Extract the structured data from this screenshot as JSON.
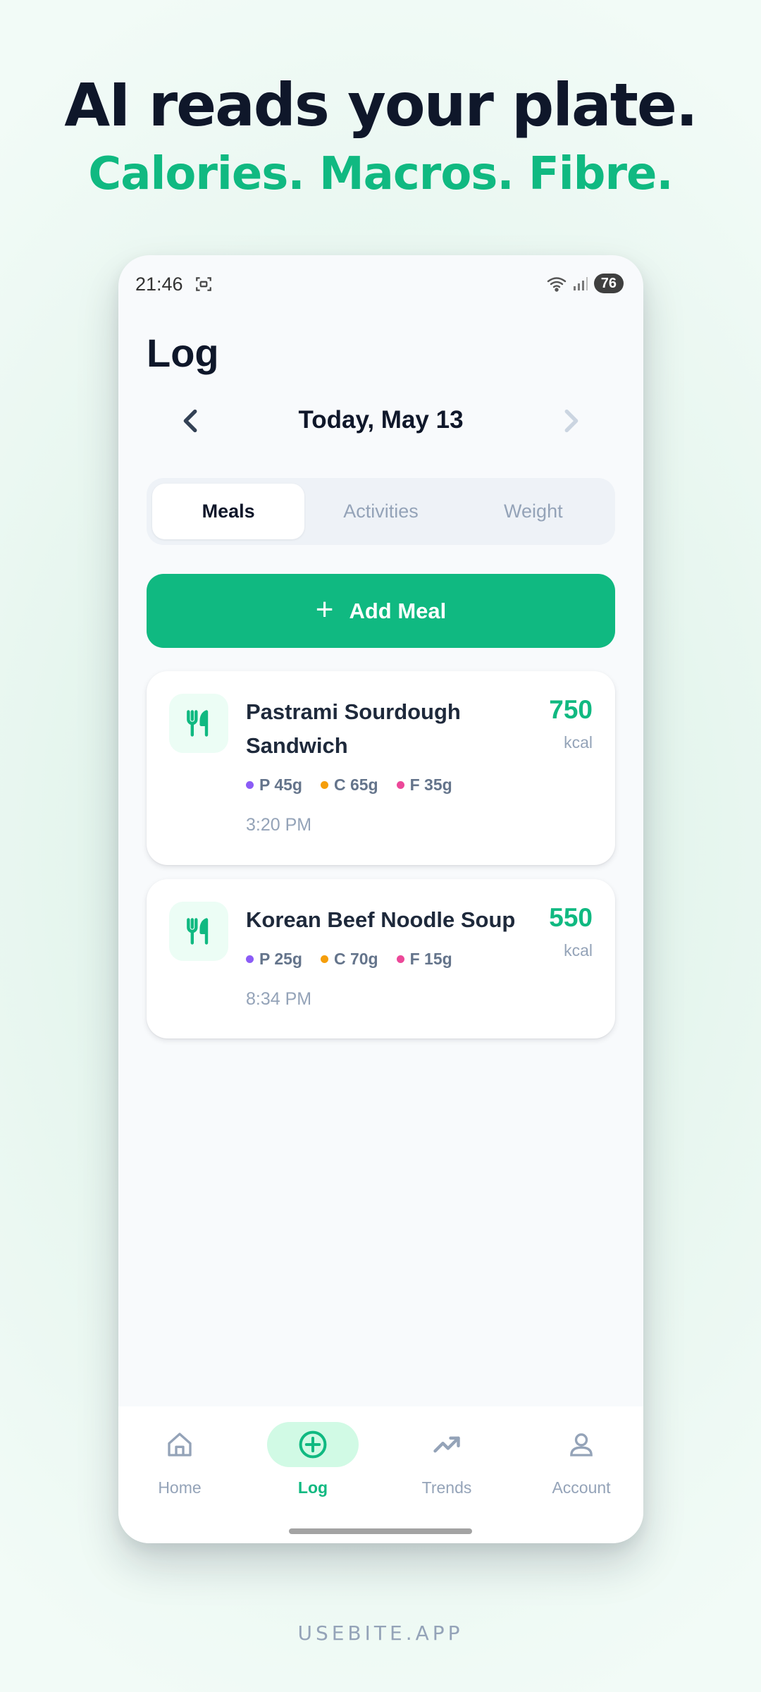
{
  "promo": {
    "headline": "AI reads your plate.",
    "subline": "Calories. Macros. Fibre.",
    "brand": "USEBITE.APP"
  },
  "status_bar": {
    "time": "21:46",
    "battery": "76"
  },
  "page": {
    "title": "Log",
    "date": "Today, May 13"
  },
  "tabs": [
    {
      "label": "Meals",
      "active": true
    },
    {
      "label": "Activities",
      "active": false
    },
    {
      "label": "Weight",
      "active": false
    }
  ],
  "add_meal_label": "Add Meal",
  "meals": [
    {
      "name": "Pastrami Sourdough Sandwich",
      "kcal": "750",
      "kcal_unit": "kcal",
      "protein": "P 45g",
      "carbs": "C 65g",
      "fat": "F 35g",
      "time": "3:20 PM"
    },
    {
      "name": "Korean Beef Noodle Soup",
      "kcal": "550",
      "kcal_unit": "kcal",
      "protein": "P 25g",
      "carbs": "C 70g",
      "fat": "F 15g",
      "time": "8:34 PM"
    }
  ],
  "bottom_nav": [
    {
      "label": "Home",
      "icon": "home-icon",
      "active": false
    },
    {
      "label": "Log",
      "icon": "plus-circle-icon",
      "active": true
    },
    {
      "label": "Trends",
      "icon": "trending-up-icon",
      "active": false
    },
    {
      "label": "Account",
      "icon": "user-icon",
      "active": false
    }
  ],
  "colors": {
    "accent": "#10b981",
    "protein": "#8b5cf6",
    "carbs": "#f59e0b",
    "fat": "#ec4899",
    "text_dark": "#0f172a",
    "muted": "#94a3b8"
  }
}
